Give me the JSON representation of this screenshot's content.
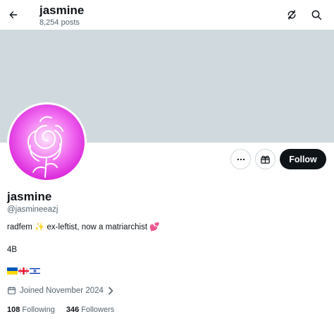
{
  "header": {
    "name": "jasmine",
    "posts": "8,254 posts",
    "back_icon": "arrow-left-icon",
    "refresh_icon": "refresh-icon",
    "search_icon": "search-icon"
  },
  "banner": {
    "color": "#cfd9de"
  },
  "profile": {
    "display_name": "jasmine",
    "handle": "@jasmineeazj",
    "bio_text_a": "radfem ",
    "bio_emoji_a": "✨",
    "bio_text_b": " ex-leftist, now a matriarchist ",
    "bio_emoji_b": "💕",
    "bio_line_2": "4B",
    "flags": [
      "ukraine-flag",
      "georgia-flag",
      "israel-flag"
    ],
    "joined": "Joined November 2024",
    "following_count": "108",
    "following_label": "Following",
    "followers_count": "346",
    "followers_label": "Followers"
  },
  "actions": {
    "more_icon": "more-icon",
    "gift_icon": "gift-icon",
    "follow_label": "Follow"
  },
  "colors": {
    "text": "#0f1419",
    "muted": "#536471",
    "border": "#cfd9de",
    "follow_bg": "#0f1419"
  }
}
